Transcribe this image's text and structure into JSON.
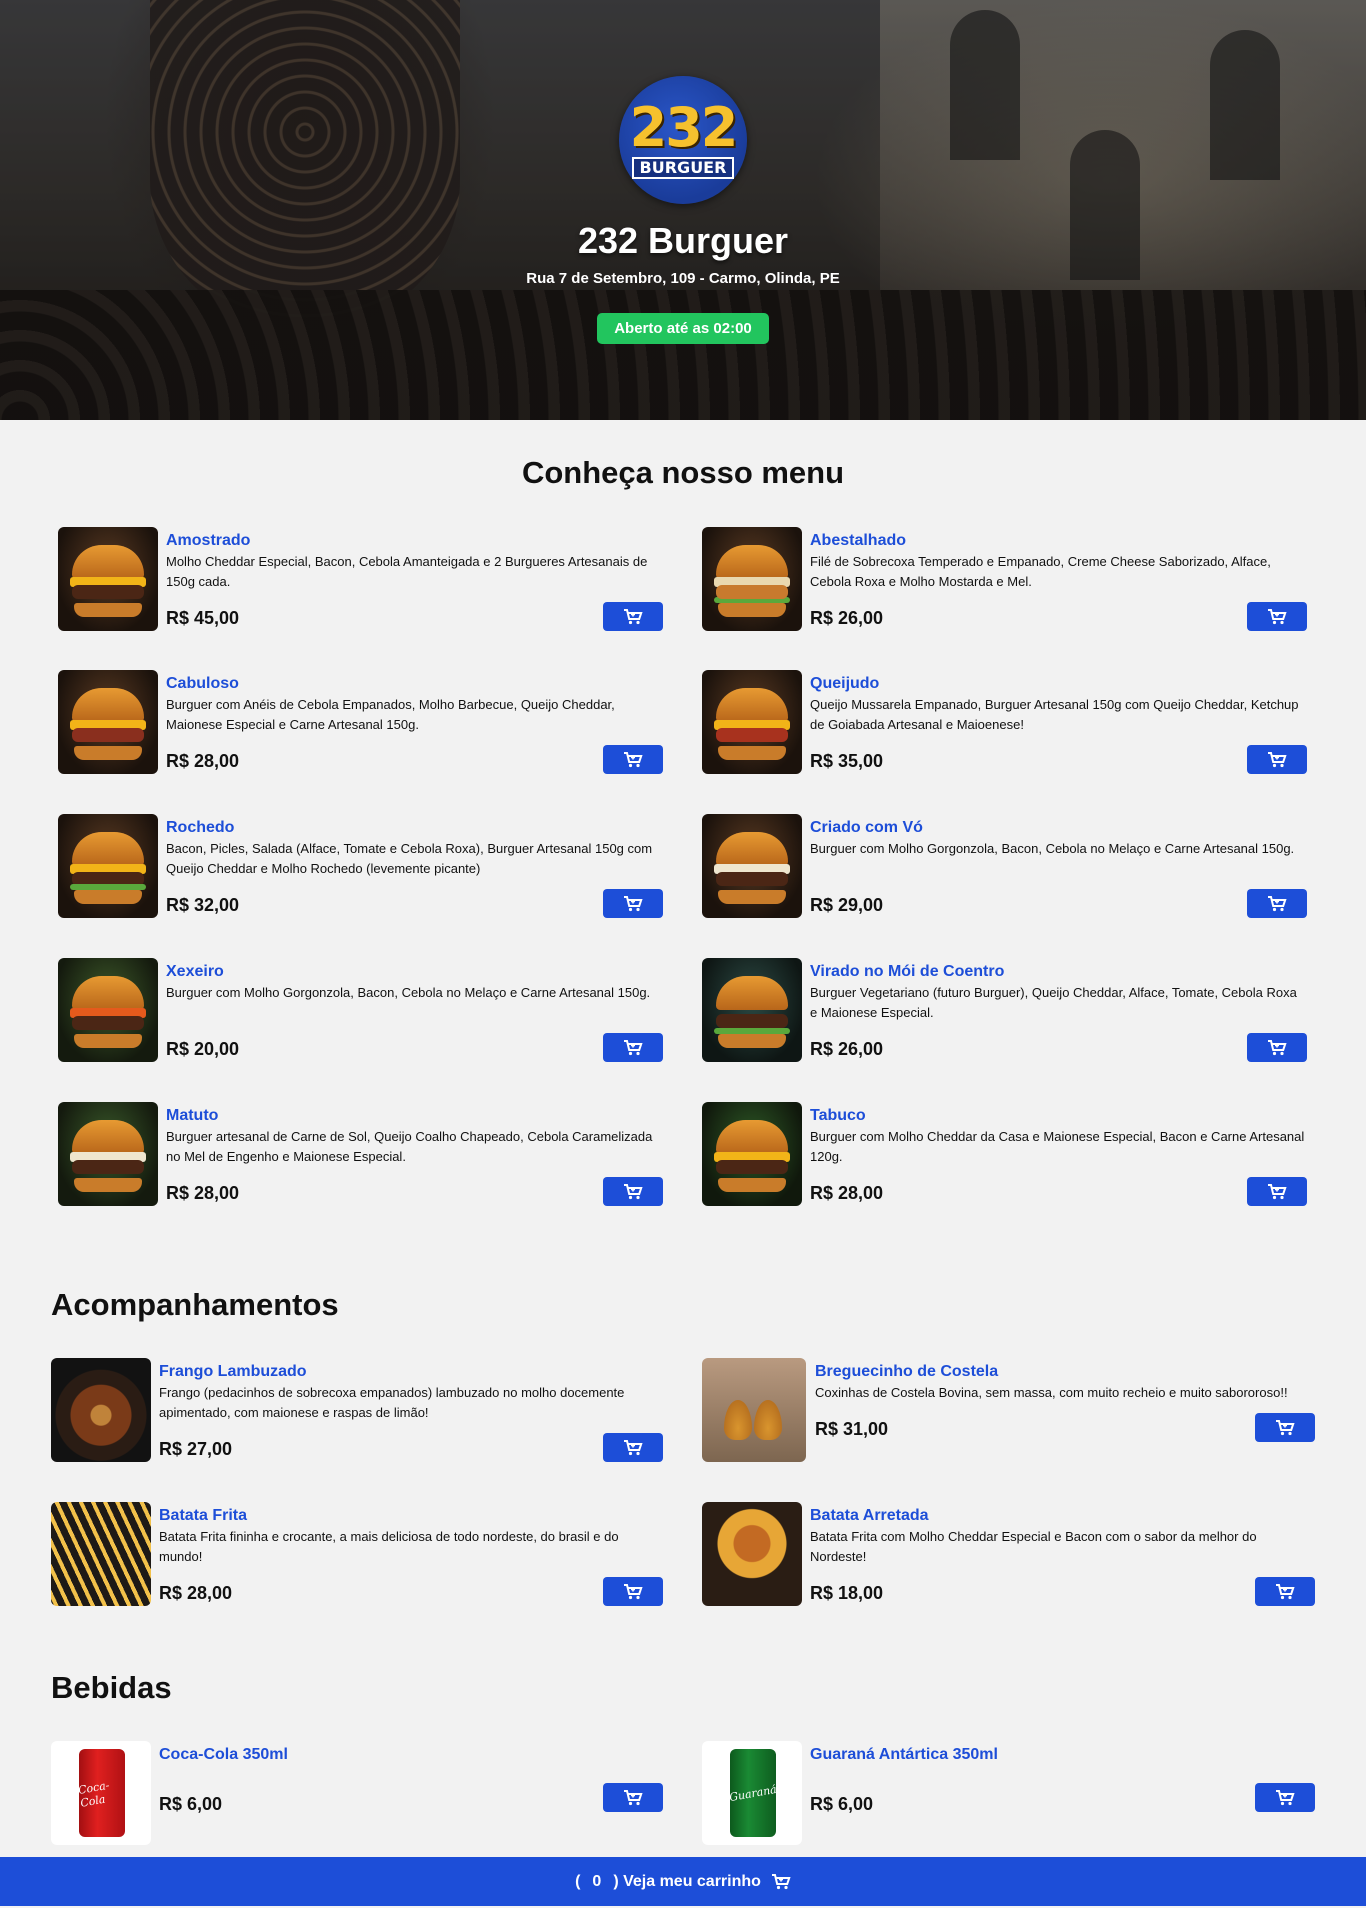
{
  "hero": {
    "logo_number": "232",
    "logo_word": "BURGUER",
    "title": "232 Burguer",
    "address": "Rua 7 de Setembro, 109 - Carmo, Olinda, PE",
    "status": "Aberto até as 02:00"
  },
  "menu": {
    "heading": "Conheça nosso menu",
    "items": [
      {
        "name": "Amostrado",
        "desc": "Molho Cheddar Especial, Bacon, Cebola Amanteigada e 2 Burgueres Artesanais de 150g cada.",
        "price": "R$ 45,00"
      },
      {
        "name": "Abestalhado",
        "desc": "Filé de Sobrecoxa Temperado e Empanado, Creme Cheese Saborizado, Alface, Cebola Roxa e Molho Mostarda e Mel.",
        "price": "R$ 26,00"
      },
      {
        "name": "Cabuloso",
        "desc": "Burguer com Anéis de Cebola Empanados, Molho Barbecue, Queijo Cheddar, Maionese Especial e Carne Artesanal 150g.",
        "price": "R$ 28,00"
      },
      {
        "name": "Queijudo",
        "desc": "Queijo Mussarela Empanado, Burguer Artesanal 150g com Queijo Cheddar, Ketchup de Goiabada Artesanal e Maioenese!",
        "price": "R$ 35,00"
      },
      {
        "name": "Rochedo",
        "desc": "Bacon, Picles, Salada (Alface, Tomate e Cebola Roxa), Burguer Artesanal 150g com Queijo Cheddar e Molho Rochedo (levemente picante)",
        "price": "R$ 32,00"
      },
      {
        "name": "Criado com Vó",
        "desc": "Burguer com Molho Gorgonzola, Bacon, Cebola no Melaço e Carne Artesanal 150g.",
        "price": "R$ 29,00"
      },
      {
        "name": "Xexeiro",
        "desc": "Burguer com Molho Gorgonzola, Bacon, Cebola no Melaço e Carne Artesanal 150g.",
        "price": "R$ 20,00"
      },
      {
        "name": "Virado no Mói de Coentro",
        "desc": "Burguer Vegetariano (futuro Burguer), Queijo Cheddar, Alface, Tomate, Cebola Roxa e Maionese Especial.",
        "price": "R$ 26,00"
      },
      {
        "name": "Matuto",
        "desc": "Burguer artesanal de Carne de Sol, Queijo Coalho Chapeado, Cebola Caramelizada no Mel de Engenho e Maionese Especial.",
        "price": "R$ 28,00"
      },
      {
        "name": "Tabuco",
        "desc": "Burguer com Molho Cheddar da Casa e Maionese Especial, Bacon e Carne Artesanal 120g.",
        "price": "R$ 28,00"
      }
    ]
  },
  "sides": {
    "heading": "Acompanhamentos",
    "items": [
      {
        "name": "Frango Lambuzado",
        "desc": "Frango (pedacinhos de sobrecoxa empanados) lambuzado no molho docemente apimentado, com maionese e raspas de limão!",
        "price": "R$ 27,00"
      },
      {
        "name": "Breguecinho de Costela",
        "desc": "Coxinhas de Costela Bovina, sem massa, com muito recheio e muito sabororoso!!",
        "price": "R$ 31,00"
      },
      {
        "name": "Batata Frita",
        "desc": "Batata Frita fininha e crocante, a mais deliciosa de todo nordeste, do brasil e do mundo!",
        "price": "R$ 28,00"
      },
      {
        "name": "Batata Arretada",
        "desc": "Batata Frita com Molho Cheddar Especial e Bacon com o sabor da melhor do Nordeste!",
        "price": "R$ 18,00"
      }
    ]
  },
  "drinks": {
    "heading": "Bebidas",
    "items": [
      {
        "name": "Coca-Cola 350ml",
        "price": "R$ 6,00",
        "can_label": "Coca-Cola"
      },
      {
        "name": "Guaraná Antártica 350ml",
        "price": "R$ 6,00",
        "can_label": "Guaraná"
      }
    ]
  },
  "cart": {
    "count": "0",
    "open_paren": "(",
    "close_label": ") Veja meu carrinho"
  },
  "icons": {
    "cart_icon": "cart-icon"
  },
  "colors": {
    "accent": "#1d4ed8",
    "open_badge": "#22c55e"
  }
}
